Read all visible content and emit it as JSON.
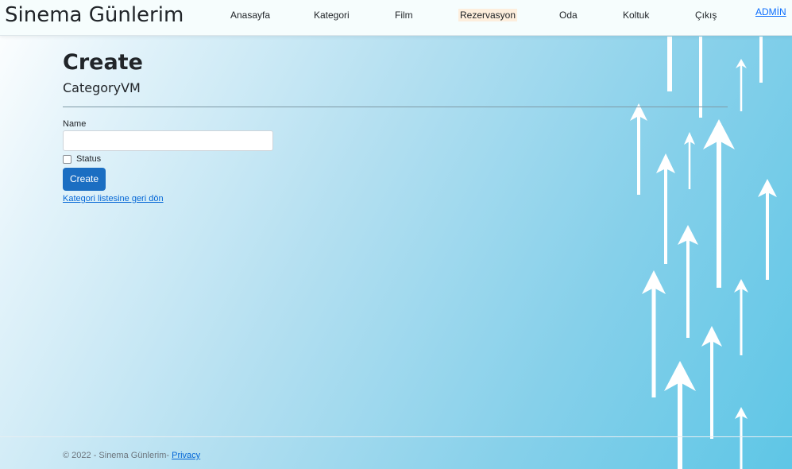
{
  "navbar": {
    "brand": "Sinema Günlerim",
    "links": [
      "Anasayfa",
      "Kategori",
      "Film",
      "Rezervasyon",
      "Oda",
      "Koltuk",
      "Çıkış"
    ],
    "admin": "ADMİN"
  },
  "main": {
    "title": "Create",
    "subtitle": "CategoryVM",
    "name_label": "Name",
    "name_value": "",
    "status_label": "Status",
    "status_checked": false,
    "create_button": "Create",
    "back_link": "Kategori listesine geri dön"
  },
  "footer": {
    "text": "© 2022 - Sinema Günlerim- ",
    "privacy": "Privacy"
  },
  "colors": {
    "primary_button": "#1b6ec2",
    "link": "#0366d6",
    "nav_highlight": "#fdeedd"
  },
  "decor": {
    "icon": "up-arrow-icon"
  }
}
